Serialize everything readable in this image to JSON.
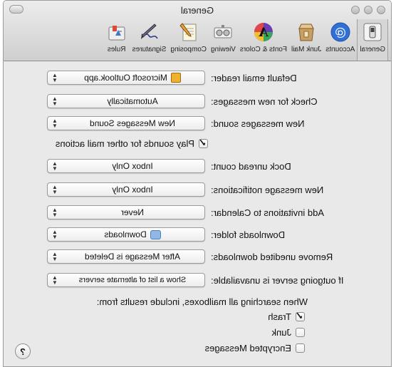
{
  "window": {
    "title": "General"
  },
  "toolbar": {
    "items": [
      {
        "label": "General",
        "icon": "switch-icon",
        "selected": true
      },
      {
        "label": "Accounts",
        "icon": "at-sign-icon"
      },
      {
        "label": "Junk Mail",
        "icon": "junk-mail-icon"
      },
      {
        "label": "Fonts & Colors",
        "icon": "fonts-colors-icon"
      },
      {
        "label": "Viewing",
        "icon": "viewing-icon"
      },
      {
        "label": "Composing",
        "icon": "composing-icon"
      },
      {
        "label": "Signatures",
        "icon": "signatures-icon"
      },
      {
        "label": "Rules",
        "icon": "rules-icon"
      }
    ]
  },
  "settings": {
    "default_email_reader": {
      "label": "Default email reader:",
      "value": "Microsoft Outlook.app"
    },
    "check_new_messages": {
      "label": "Check for new messages:",
      "value": "Automatically"
    },
    "new_messages_sound": {
      "label": "New messages sound:",
      "value": "New Messages Sound"
    },
    "play_sounds": {
      "label": "Play sounds for other mail actions",
      "checked": true
    },
    "dock_unread_count": {
      "label": "Dock unread count:",
      "value": "Inbox Only"
    },
    "new_message_notifications": {
      "label": "New message notifications:",
      "value": "Inbox Only"
    },
    "add_invitations": {
      "label": "Add invitations to Calendar:",
      "value": "Never"
    },
    "downloads_folder": {
      "label": "Downloads folder:",
      "value": "Downloads"
    },
    "remove_unedited_downloads": {
      "label": "Remove unedited downloads:",
      "value": "After Message is Deleted"
    },
    "outgoing_server_unavailable": {
      "label": "If outgoing server is unavailable:",
      "value": "Show a list of alternate servers"
    },
    "search_heading": "When searching all mailboxes, include results from:",
    "search_trash": {
      "label": "Trash",
      "checked": true
    },
    "search_junk": {
      "label": "Junk",
      "checked": false
    },
    "search_encrypted": {
      "label": "Encrypted Messages",
      "checked": false
    }
  },
  "help": {
    "label": "?"
  },
  "colors": {
    "accent": "#2f6fd6",
    "window_bg": "#e9e9e9"
  }
}
